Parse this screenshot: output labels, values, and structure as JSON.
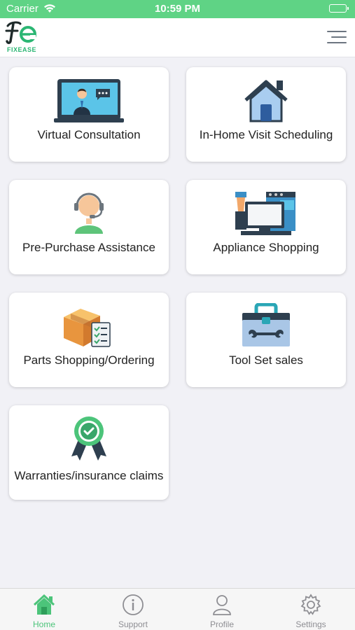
{
  "status_bar": {
    "carrier": "Carrier",
    "time": "10:59 PM"
  },
  "header": {
    "logo_text": "FIXEASE",
    "menu_icon": "hamburger-icon"
  },
  "services": [
    {
      "label": "Virtual Consultation",
      "icon": "video-call-icon"
    },
    {
      "label": "In-Home Visit Scheduling",
      "icon": "house-icon"
    },
    {
      "label": "Pre-Purchase Assistance",
      "icon": "support-agent-icon"
    },
    {
      "label": "Appliance Shopping",
      "icon": "appliances-icon"
    },
    {
      "label": "Parts Shopping/Ordering",
      "icon": "parts-box-icon"
    },
    {
      "label": "Tool Set sales",
      "icon": "toolbox-icon"
    },
    {
      "label": "Warranties/insurance claims",
      "icon": "warranty-badge-icon"
    }
  ],
  "tabs": [
    {
      "label": "Home",
      "icon": "home-icon",
      "active": true
    },
    {
      "label": "Support",
      "icon": "info-icon",
      "active": false
    },
    {
      "label": "Profile",
      "icon": "user-icon",
      "active": false
    },
    {
      "label": "Settings",
      "icon": "gear-icon",
      "active": false
    }
  ],
  "colors": {
    "status_bar": "#5fd385",
    "accent": "#4cc47a",
    "background": "#f1f1f6"
  }
}
